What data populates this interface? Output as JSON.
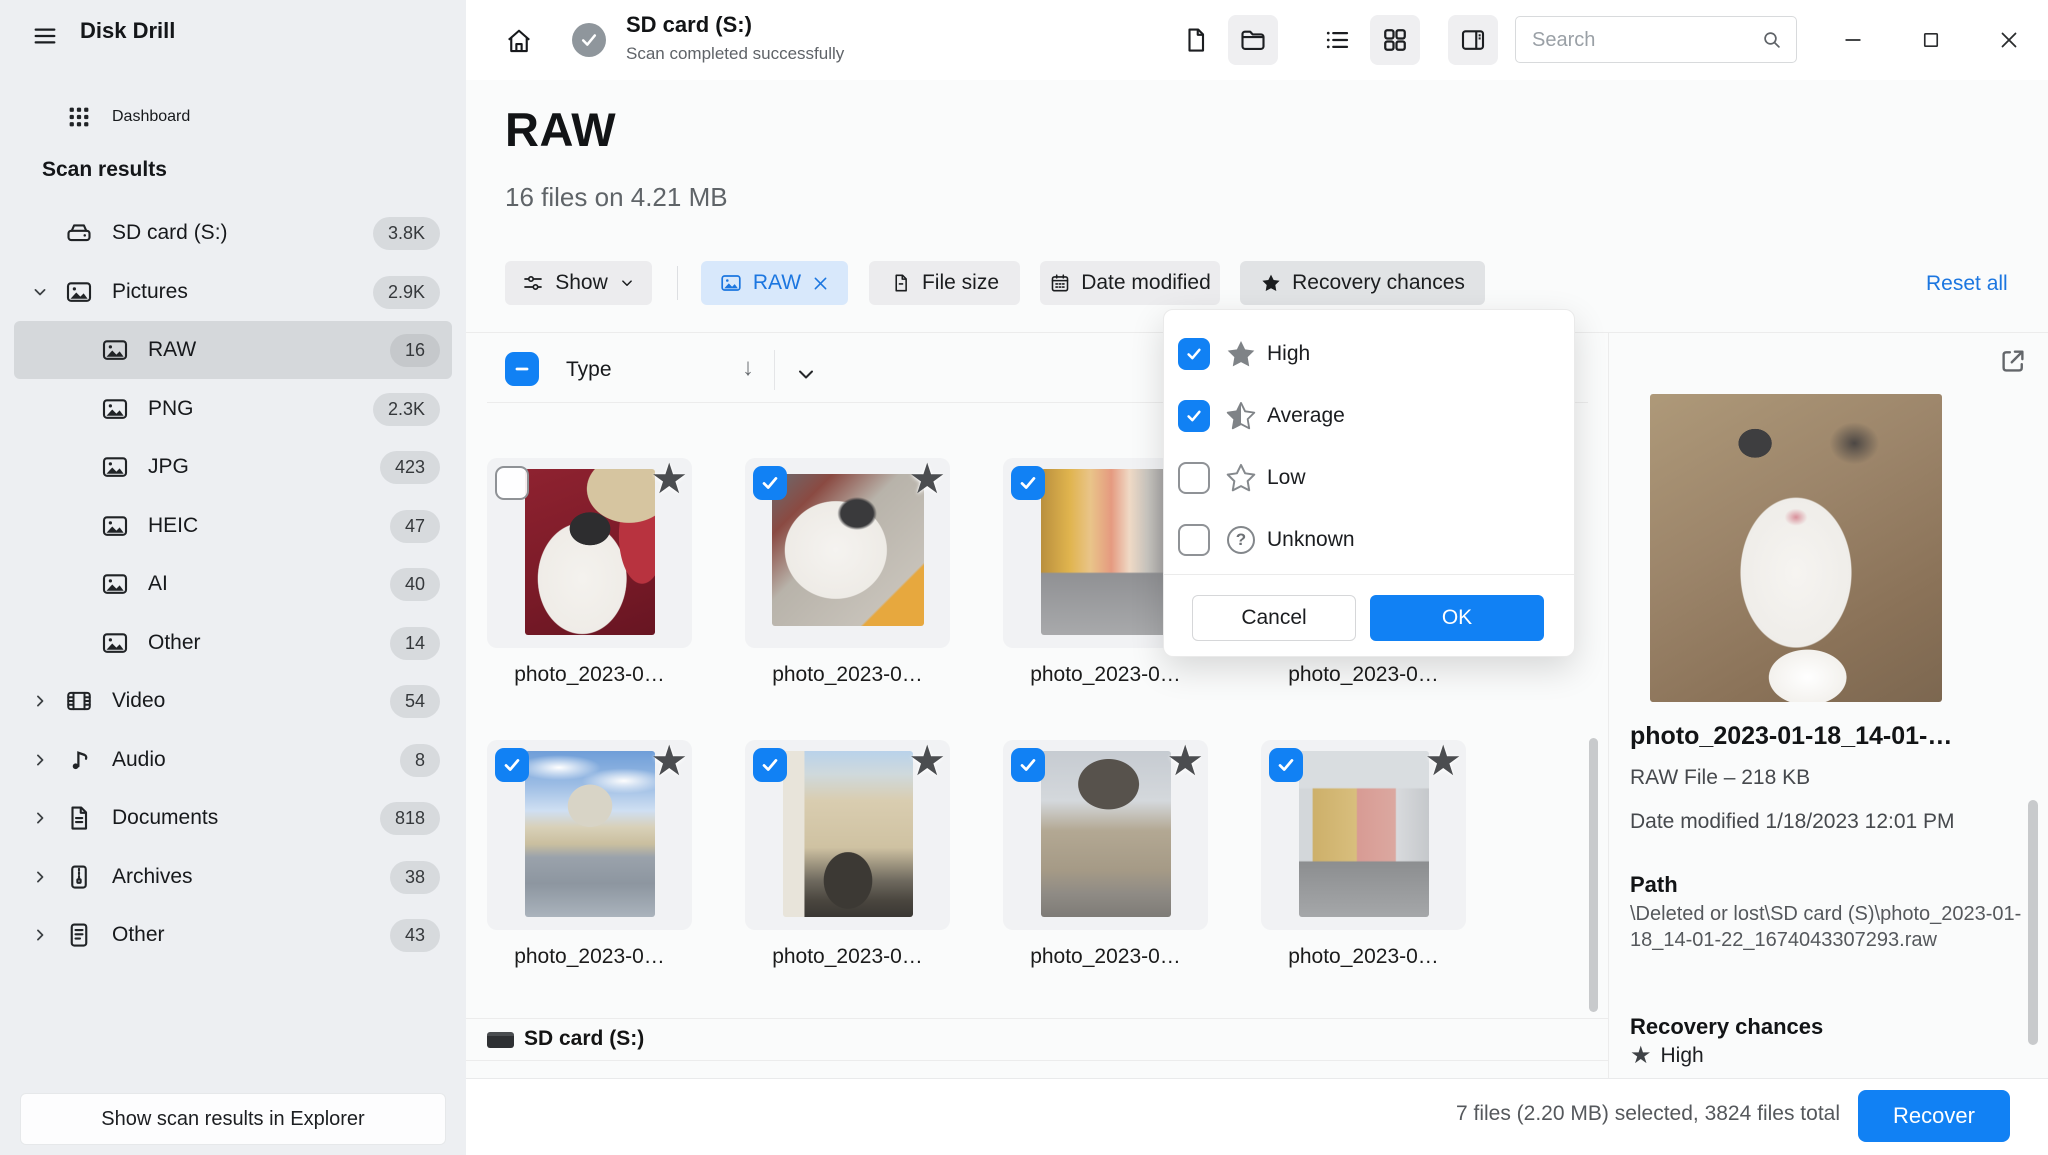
{
  "app": {
    "name": "Disk Drill"
  },
  "header": {
    "title": "SD card (S:)",
    "subtitle": "Scan completed successfully",
    "search_placeholder": "Search",
    "view_icons": [
      "file-icon",
      "folder-icon",
      "list-view-icon",
      "grid-view-icon",
      "preview-panel-icon"
    ]
  },
  "sidebar": {
    "dashboard_label": "Dashboard",
    "section_title": "Scan results",
    "items": [
      {
        "label": "SD card (S:)",
        "badge": "3.8K",
        "icon": "drive-icon"
      },
      {
        "label": "Pictures",
        "badge": "2.9K",
        "icon": "image-icon",
        "state": "expanded"
      },
      {
        "label": "RAW",
        "badge": "16",
        "icon": "image-icon",
        "state": "selected"
      },
      {
        "label": "PNG",
        "badge": "2.3K",
        "icon": "image-icon"
      },
      {
        "label": "JPG",
        "badge": "423",
        "icon": "image-icon"
      },
      {
        "label": "HEIC",
        "badge": "47",
        "icon": "image-icon"
      },
      {
        "label": "AI",
        "badge": "40",
        "icon": "image-icon"
      },
      {
        "label": "Other",
        "badge": "14",
        "icon": "image-icon"
      },
      {
        "label": "Video",
        "badge": "54",
        "icon": "video-icon",
        "state": "collapsed"
      },
      {
        "label": "Audio",
        "badge": "8",
        "icon": "audio-icon",
        "state": "collapsed"
      },
      {
        "label": "Documents",
        "badge": "818",
        "icon": "document-icon",
        "state": "collapsed"
      },
      {
        "label": "Archives",
        "badge": "38",
        "icon": "archive-icon",
        "state": "collapsed"
      },
      {
        "label": "Other",
        "badge": "43",
        "icon": "file-icon",
        "state": "collapsed"
      }
    ],
    "footer_button": "Show scan results in Explorer"
  },
  "content": {
    "title": "RAW",
    "subtitle": "16 files on 4.21 MB",
    "filter_bar": {
      "show_label": "Show",
      "raw_chip": "RAW",
      "file_size_label": "File size",
      "date_modified_label": "Date modified",
      "recovery_chances_label": "Recovery chances",
      "reset_label": "Reset all"
    },
    "list_header": {
      "column_label": "Type"
    },
    "files": [
      {
        "name": "photo_2023-0…",
        "selected": false,
        "starred": true,
        "thumb": "cat-on-red-chair"
      },
      {
        "name": "photo_2023-0…",
        "selected": true,
        "starred": true,
        "thumb": "cat-closeup"
      },
      {
        "name": "photo_2023-0…",
        "selected": true,
        "starred": true,
        "thumb": "yellow-street-buildings"
      },
      {
        "name": "photo_2023-0…",
        "selected": true,
        "starred": true,
        "thumb": "old-town-street"
      },
      {
        "name": "photo_2023-0…",
        "selected": true,
        "starred": true,
        "thumb": "cathedral-rainy-square"
      },
      {
        "name": "photo_2023-0…",
        "selected": true,
        "starred": true,
        "thumb": "courtyard-arcades"
      },
      {
        "name": "photo_2023-0…",
        "selected": true,
        "starred": true,
        "thumb": "baroque-church"
      },
      {
        "name": "photo_2023-0…",
        "selected": true,
        "starred": true,
        "thumb": "town-square-buildings"
      }
    ],
    "group_footer_label": "SD card (S:)"
  },
  "recovery_popup": {
    "options": [
      {
        "label": "High",
        "checked": true,
        "icon": "star-filled-icon"
      },
      {
        "label": "Average",
        "checked": true,
        "icon": "star-half-icon"
      },
      {
        "label": "Low",
        "checked": false,
        "icon": "star-outline-icon"
      },
      {
        "label": "Unknown",
        "checked": false,
        "icon": "question-circle-icon"
      }
    ],
    "cancel_label": "Cancel",
    "ok_label": "OK"
  },
  "preview": {
    "filename": "photo_2023-01-18_14-01-…",
    "type_size": "RAW File – 218 KB",
    "date_modified": "Date modified 1/18/2023 12:01 PM",
    "path_label": "Path",
    "path_value": "\\Deleted or lost\\SD card (S)\\photo_2023-01-18_14-01-22_1674043307293.raw",
    "recovery_label": "Recovery chances",
    "recovery_value": "High"
  },
  "footer": {
    "selection_summary": "7 files (2.20 MB) selected, 3824 files total",
    "recover_label": "Recover"
  },
  "colors": {
    "accent": "#1181f4",
    "chip_active_bg": "#d8e8fb",
    "chip_text": "#1b76e0",
    "link": "#1b76e0",
    "sidebar_bg": "#edeff2",
    "selected_row": "#d5d8db",
    "star_gray": "#7f8387"
  }
}
